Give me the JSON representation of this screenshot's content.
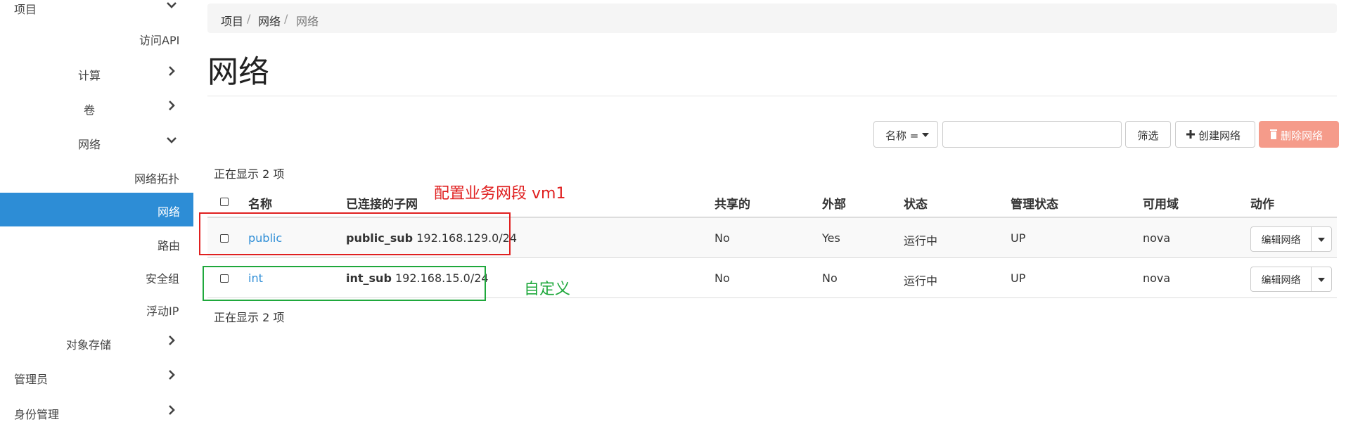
{
  "sidebar": {
    "top_item": "项目",
    "items": [
      {
        "label": "访问API"
      },
      {
        "label": "计算"
      },
      {
        "label": "卷"
      },
      {
        "label": "网络"
      },
      {
        "label": "网络拓扑"
      },
      {
        "label": "网络"
      },
      {
        "label": "路由"
      },
      {
        "label": "安全组"
      },
      {
        "label": "浮动IP"
      },
      {
        "label": "对象存储"
      },
      {
        "label": "管理员"
      },
      {
        "label": "身份管理"
      }
    ]
  },
  "breadcrumb": [
    "项目",
    "网络",
    "网络"
  ],
  "breadcrumb_sep": "/",
  "page_title": "网络",
  "toolbar": {
    "filter_select": "名称 =",
    "filter_button": "筛选",
    "create_button": "创建网络",
    "delete_button": "删除网络"
  },
  "count_text": "正在显示 2 项",
  "table": {
    "headers": [
      "名称",
      "已连接的子网",
      "共享的",
      "外部",
      "状态",
      "管理状态",
      "可用域",
      "动作"
    ],
    "rows": [
      {
        "name": "public",
        "subnet_name": "public_sub",
        "subnet_cidr": "192.168.129.0/24",
        "shared": "No",
        "external": "Yes",
        "status": "运行中",
        "admin_state": "UP",
        "zone": "nova",
        "action": "编辑网络"
      },
      {
        "name": "int",
        "subnet_name": "int_sub",
        "subnet_cidr": "192.168.15.0/24",
        "shared": "No",
        "external": "No",
        "status": "运行中",
        "admin_state": "UP",
        "zone": "nova",
        "action": "编辑网络"
      }
    ]
  },
  "annotations": {
    "red_label": "配置业务网段 vm1",
    "green_label": "自定义",
    "red_color": "#e02020",
    "green_color": "#1fa83c"
  },
  "colors": {
    "accent": "#2d8dd6",
    "danger": "#f59b8a"
  }
}
